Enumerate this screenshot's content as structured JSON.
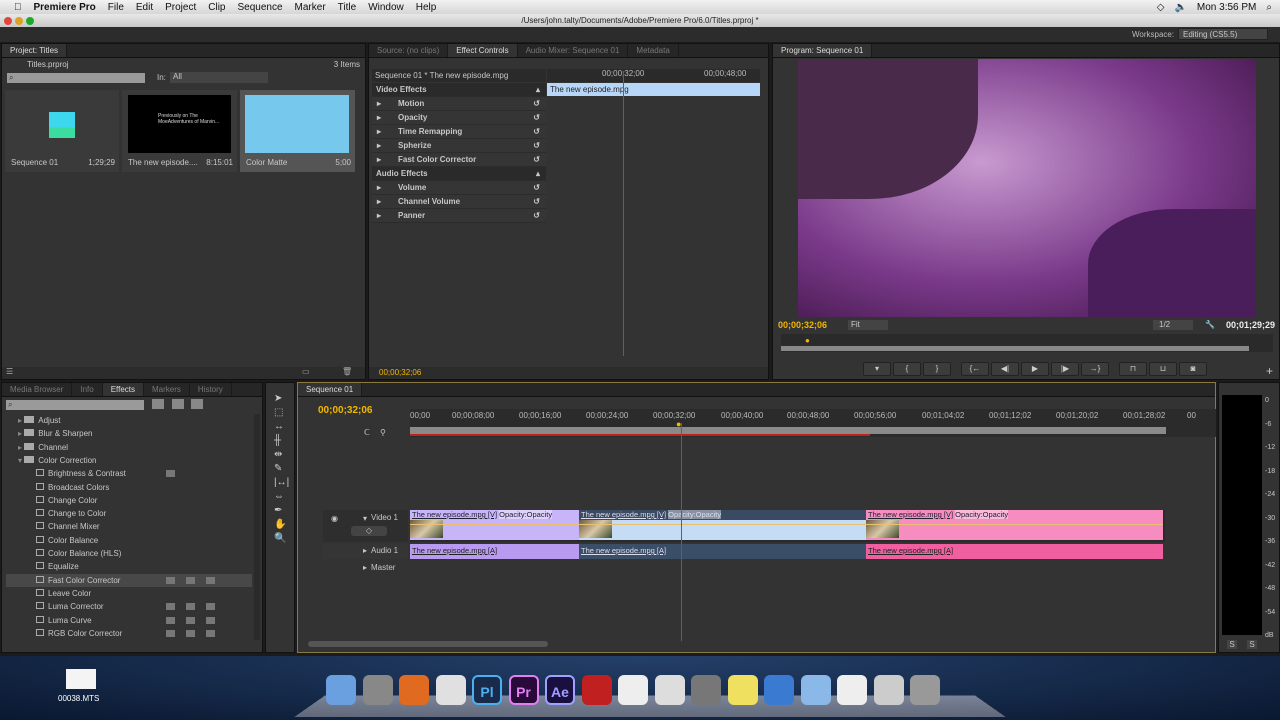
{
  "menubar": {
    "app": "Premiere Pro",
    "items": [
      "File",
      "Edit",
      "Project",
      "Clip",
      "Sequence",
      "Marker",
      "Title",
      "Window",
      "Help"
    ],
    "clock": "Mon 3:56 PM"
  },
  "window": {
    "title": "/Users/john.talty/Documents/Adobe/Premiere Pro/6.0/Titles.prproj *"
  },
  "workspace": {
    "label": "Workspace:",
    "value": "Editing (CS5.5)"
  },
  "project": {
    "tab": "Project: Titles",
    "file": "Titles.prproj",
    "count": "3 Items",
    "in_label": "In:",
    "in_value": "All",
    "items": [
      {
        "name": "Sequence 01",
        "duration": "1;29;29"
      },
      {
        "name": "The new episode....",
        "duration": "8:15:01",
        "thumb_text": "Previously on The MoeAdventures of Marvin..."
      },
      {
        "name": "Color Matte",
        "duration": "5;00"
      }
    ]
  },
  "effect_controls": {
    "tabs": [
      "Source: (no clips)",
      "Effect Controls",
      "Audio Mixer: Sequence 01",
      "Metadata"
    ],
    "header": "Sequence 01 * The new episode.mpg",
    "ruler": [
      "00;00;32;00",
      "00;00;48;00"
    ],
    "clip": "The new episode.mpg",
    "timecode": "00;00;32;06",
    "rows": [
      {
        "label": "Video Effects",
        "section": true
      },
      {
        "label": "Motion"
      },
      {
        "label": "Opacity"
      },
      {
        "label": "Time Remapping"
      },
      {
        "label": "Spherize"
      },
      {
        "label": "Fast Color Corrector"
      },
      {
        "label": "Audio Effects",
        "section": true
      },
      {
        "label": "Volume"
      },
      {
        "label": "Channel Volume"
      },
      {
        "label": "Panner"
      }
    ]
  },
  "program": {
    "tab": "Program: Sequence 01",
    "timecode": "00;00;32;06",
    "fit": "Fit",
    "resolution": "1/2",
    "duration": "00;01;29;29"
  },
  "effects": {
    "tabs": [
      "Media Browser",
      "Info",
      "Effects",
      "Markers",
      "History"
    ],
    "active_tab": "Effects",
    "folders": [
      "Adjust",
      "Blur & Sharpen",
      "Channel",
      "Color Correction"
    ],
    "items": [
      "Brightness & Contrast",
      "Broadcast Colors",
      "Change Color",
      "Change to Color",
      "Channel Mixer",
      "Color Balance",
      "Color Balance (HLS)",
      "Equalize",
      "Fast Color Corrector",
      "Leave Color",
      "Luma Corrector",
      "Luma Curve",
      "RGB Color Corrector"
    ],
    "selected": "Fast Color Corrector"
  },
  "timeline": {
    "tab": "Sequence 01",
    "timecode": "00;00;32;06",
    "ruler": [
      "00;00",
      "00;00;08;00",
      "00;00;16;00",
      "00;00;24;00",
      "00;00;32;00",
      "00;00;40;00",
      "00;00;48;00",
      "00;00;56;00",
      "00;01;04;02",
      "00;01;12;02",
      "00;01;20;02",
      "00;01;28;02",
      "00"
    ],
    "tracks": {
      "video": "Video 1",
      "audio": "Audio 1",
      "master": "Master"
    },
    "video_clips": [
      {
        "label": "The new episode.mpg [V]",
        "fx": "Opacity:Opacity",
        "color": "#c8b4f8"
      },
      {
        "label": "The new episode.mpg [V]",
        "fx": "Opacity:Opacity",
        "color": "#c4dcf6"
      },
      {
        "label": "The new episode.mpg [V]",
        "fx": "Opacity:Opacity",
        "color": "#f78cc0"
      }
    ],
    "audio_clips": [
      {
        "label": "The new episode.mpg [A]",
        "color": "#b89af0"
      },
      {
        "label": "The new episode.mpg [A]",
        "color": "#3a4e68"
      },
      {
        "label": "The new episode.mpg [A]",
        "color": "#f060a0"
      }
    ]
  },
  "meter": {
    "scale": [
      "0",
      "-6",
      "-12",
      "-18",
      "-24",
      "-30",
      "-36",
      "-42",
      "-48",
      "-54",
      "dB"
    ],
    "solo": "S"
  },
  "desktop": {
    "file": "00038.MTS",
    "dock": [
      "Finder",
      "Launchpad",
      "Firefox",
      "Chrome",
      "Pl",
      "Pr",
      "Ae",
      "Photo Booth",
      "TextEdit",
      "Calculator",
      "System Preferences",
      "Stickies",
      "QuickTime",
      "Applications",
      "Documents",
      "Mail",
      "Trash"
    ]
  }
}
